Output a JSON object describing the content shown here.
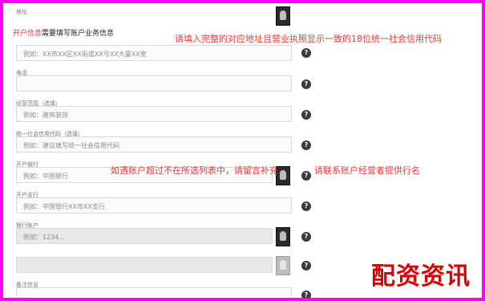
{
  "top_label": "地址",
  "section_title_highlight": "开户信息",
  "section_title_rest": "需要填写账户业务信息",
  "rows": [
    {
      "label": "",
      "placeholder": "例如：XX市XX区XX街道XX号XX大厦XX室"
    },
    {
      "label": "电话",
      "placeholder": ""
    },
    {
      "label": "经营范围（选填）",
      "placeholder": "例如：建筑装饰"
    },
    {
      "label": "统一社会信用代码（选填）",
      "placeholder": "例如：建议填写统一社会信用代码"
    },
    {
      "label": "开户银行",
      "placeholder": "例如：中国银行"
    },
    {
      "label": "开户支行",
      "placeholder": "例如：中国银行XX市XX支行"
    },
    {
      "label": "银行账户",
      "placeholder": "例如：1234..."
    },
    {
      "label": "",
      "placeholder": ""
    },
    {
      "label": "备注信息",
      "placeholder": ""
    }
  ],
  "annotations": {
    "top_right": "请填入完整的对应地址且营业执照显示一致的18位统一社会信用代码",
    "middle_left": "如遇账户超过不在所选列表中，请留言补充",
    "middle_right": "请联系账户经营者提供行名"
  },
  "help_icon_label": "?",
  "watermark": "配资资讯",
  "colors": {
    "border": "#ff00ff",
    "annotation": "#e23b3b",
    "watermark": "#d80000"
  }
}
